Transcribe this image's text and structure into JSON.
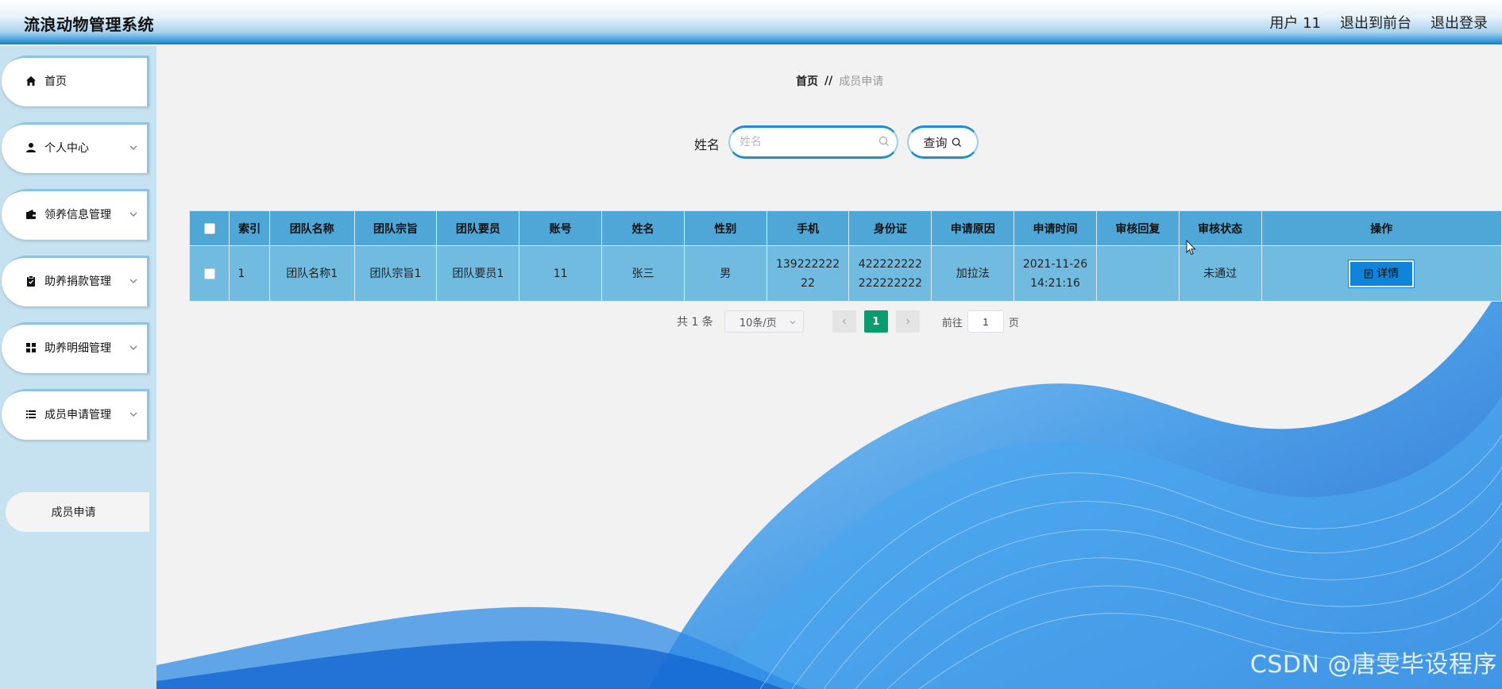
{
  "header": {
    "app_title": "流浪动物管理系统",
    "user_label": "用户 11",
    "to_front_label": "退出到前台",
    "logout_label": "退出登录"
  },
  "sidebar": {
    "items": [
      {
        "label": "首页",
        "icon": "home-icon"
      },
      {
        "label": "个人中心",
        "icon": "user-icon"
      },
      {
        "label": "领养信息管理",
        "icon": "wallet-icon"
      },
      {
        "label": "助养捐款管理",
        "icon": "clipboard-icon"
      },
      {
        "label": "助养明细管理",
        "icon": "grid-icon"
      },
      {
        "label": "成员申请管理",
        "icon": "list-icon"
      }
    ],
    "sub_item": "成员申请"
  },
  "breadcrumb": {
    "home": "首页",
    "separator": "//",
    "current": "成员申请"
  },
  "search": {
    "label": "姓名",
    "placeholder": "姓名",
    "value": "",
    "button_label": "查询"
  },
  "table": {
    "headers": [
      "索引",
      "团队名称",
      "团队宗旨",
      "团队要员",
      "账号",
      "姓名",
      "性别",
      "手机",
      "身份证",
      "申请原因",
      "申请时间",
      "审核回复",
      "审核状态",
      "操作"
    ],
    "rows": [
      {
        "index": "1",
        "team_name": "团队名称1",
        "team_purpose": "团队宗旨1",
        "team_member": "团队要员1",
        "account": "11",
        "name": "张三",
        "gender": "男",
        "phone_line1": "139222222",
        "phone_line2": "22",
        "id_line1": "422222222",
        "id_line2": "222222222",
        "reason": "加拉法",
        "time_line1": "2021-11-26",
        "time_line2": "14:21:16",
        "reply": "",
        "status": "未通过",
        "action_label": "详情"
      }
    ]
  },
  "pagination": {
    "total": "共 1 条",
    "page_size": "10条/页",
    "current_page": "1",
    "goto_label": "前往",
    "goto_value": "1",
    "page_unit": "页"
  },
  "watermark": "CSDN @唐雯毕设程序",
  "colors": {
    "header_accent": "#1e8fd6",
    "table_header": "#4ea7d6",
    "table_row": "#72bbe0",
    "detail_button": "#0f84d8",
    "current_page": "#0a9b6f"
  }
}
